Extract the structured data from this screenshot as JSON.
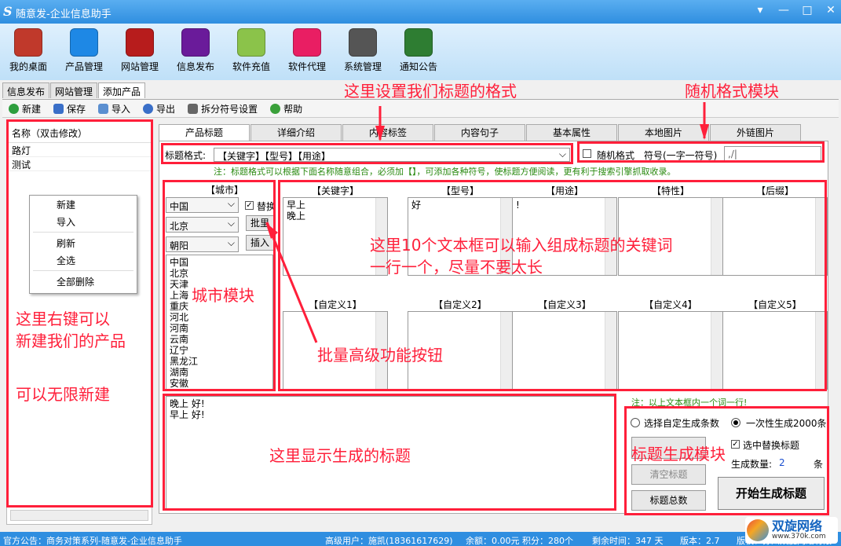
{
  "window": {
    "title": "随意发-企业信息助手",
    "logo_letter": "S"
  },
  "toolbar": [
    "我的桌面",
    "产品管理",
    "网站管理",
    "信息发布",
    "软件充值",
    "软件代理",
    "系统管理",
    "通知公告"
  ],
  "toolbar_colors": [
    "#c0392b",
    "#1e88e5",
    "#b71c1c",
    "#6a1b9a",
    "#8bc34a",
    "#e91e63",
    "#555555",
    "#2e7d32"
  ],
  "main_tabs": [
    "信息发布",
    "网站管理",
    "添加产品"
  ],
  "actions": [
    "新建",
    "保存",
    "导入",
    "导出",
    "拆分符号设置",
    "帮助"
  ],
  "product_list": {
    "header": "名称（双击修改）",
    "items": [
      "路灯",
      "测试"
    ]
  },
  "context_menu": [
    "新建",
    "导入",
    "刷新",
    "全选",
    "全部删除"
  ],
  "sub_tabs": [
    "产品标题",
    "详细介绍",
    "内容标签",
    "内容句子",
    "基本属性",
    "本地图片",
    "外链图片"
  ],
  "format": {
    "label": "标题格式:",
    "value": "【关键字】【型号】【用途】",
    "random_label": "随机格式",
    "symbol_label": "符号(一字一符号)",
    "symbol_value": ",/|"
  },
  "notice": "注：标题格式可以根据下面名称随意组合，必须加【】，可添加各种符号，使标题方便阅读，更有利于搜索引擎抓取收录。",
  "city": {
    "title": "【城市】",
    "province": "中国",
    "city": "北京",
    "district": "朝阳",
    "replace_label": "替换",
    "batch_label": "批里",
    "insert_label": "插入",
    "list": [
      "中国",
      "北京",
      "天津",
      "上海",
      "重庆",
      "河北",
      "河南",
      "云南",
      "辽宁",
      "黑龙江",
      "湖南",
      "安徽"
    ]
  },
  "fields": {
    "row1": [
      {
        "label": "【关键字】",
        "text": "早上\n晚上"
      },
      {
        "label": "【型号】",
        "text": "好"
      },
      {
        "label": "【用途】",
        "text": "!"
      },
      {
        "label": "【特性】",
        "text": ""
      },
      {
        "label": "【后缀】",
        "text": ""
      }
    ],
    "row2": [
      {
        "label": "【自定义1】",
        "text": ""
      },
      {
        "label": "【自定义2】",
        "text": ""
      },
      {
        "label": "【自定义3】",
        "text": ""
      },
      {
        "label": "【自定义4】",
        "text": ""
      },
      {
        "label": "【自定义5】",
        "text": ""
      }
    ]
  },
  "output": "晚上 好!\n早上 好!",
  "right_note": "注：以上文本框内一个词一行!",
  "gen": {
    "opt1": "选择自定生成条数",
    "opt2": "一次性生成2000条",
    "replace": "选中替换标题",
    "count_label": "生成数量:",
    "count": "2",
    "unit": "条",
    "clear": "清空标题",
    "total": "标题总数",
    "start": "开始生成标题"
  },
  "status": {
    "left": "官方公告：商务对策系列-随意发-企业信息助手",
    "user": "高级用户：施凯(18361617629)",
    "balance": "余额：0.00元 积分：280个",
    "remain": "剩余时间：347 天",
    "version": "版本：2.7",
    "copyright": "版权：苏州双旋网络有限"
  },
  "watermark": {
    "name": "双旋网络",
    "url": "www.370k.com"
  },
  "annotations": {
    "format": "这里设置我们标题的格式",
    "random": "随机格式模块",
    "left1": "这里右键可以",
    "left2": "新建我们的产品",
    "left3": "可以无限新建",
    "city": "城市模块",
    "batch": "批量高级功能按钮",
    "kw1": "这里10个文本框可以输入组成标题的关键词",
    "kw2": "一行一个，尽量不要太长",
    "output": "这里显示生成的标题",
    "gen": "标题生成模块"
  }
}
